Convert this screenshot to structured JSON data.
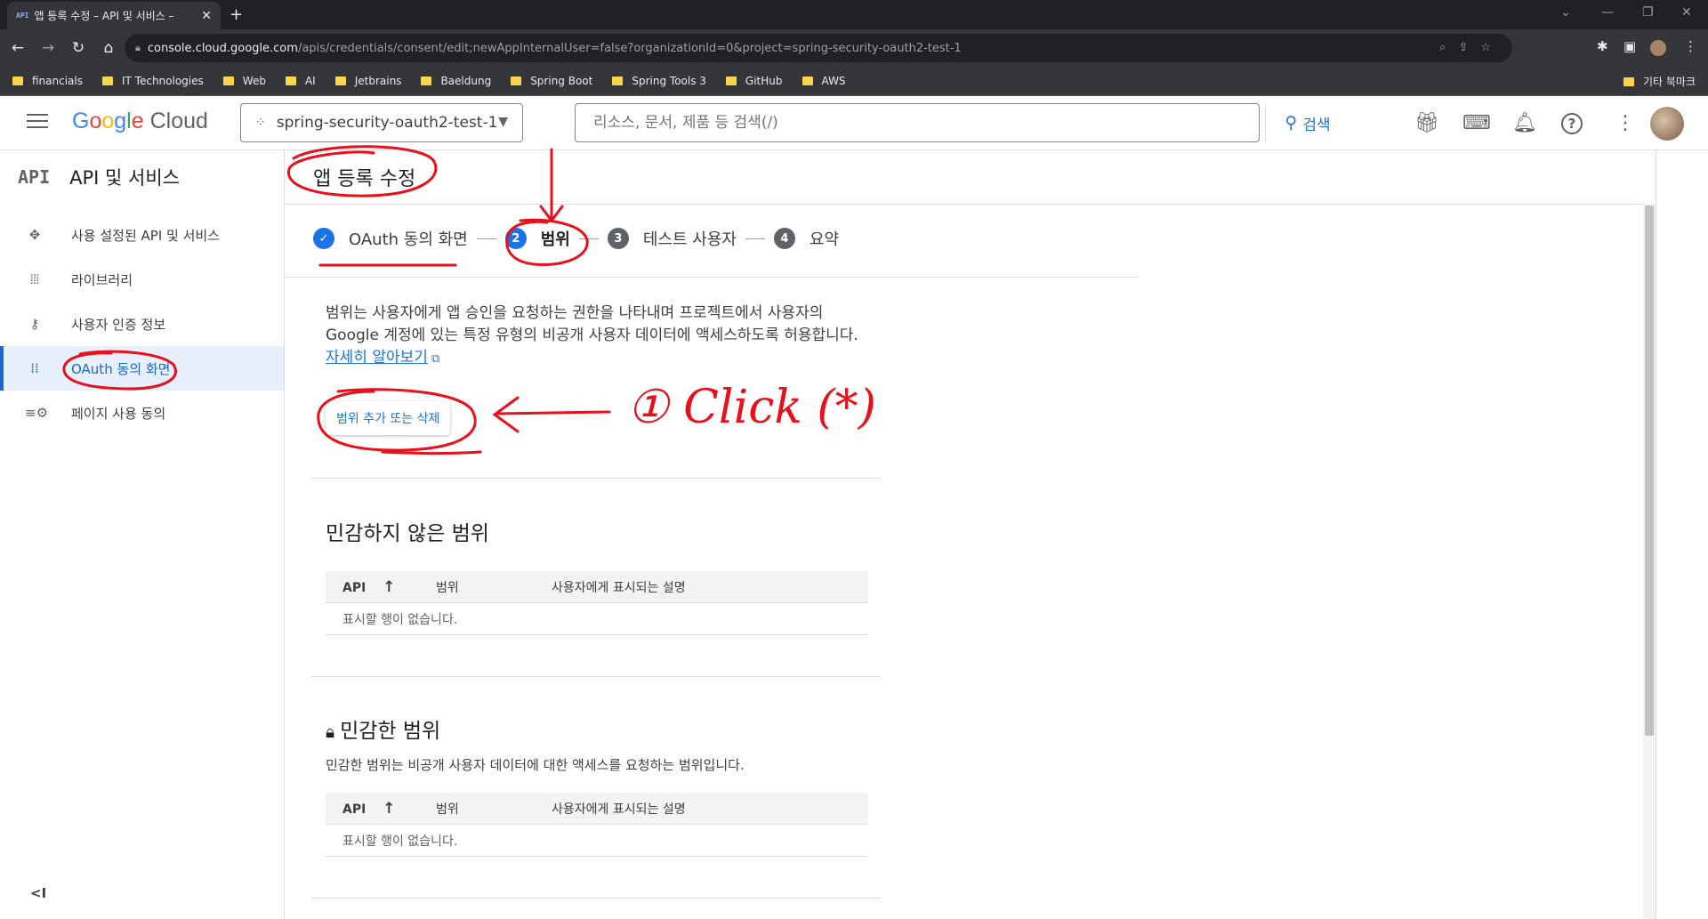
{
  "browser": {
    "tab_favicon": "API",
    "tab_title": "앱 등록 수정 – API 및 서비스 – ",
    "new_tab": "+",
    "url_host": "console.cloud.google.com",
    "url_path": "/apis/credentials/consent/edit;newAppInternalUser=false?organizationId=0&project=spring-security-oauth2-test-1",
    "bookmarks": [
      "financials",
      "IT Technologies",
      "Web",
      "AI",
      "Jetbrains",
      "Baeldung",
      "Spring Boot",
      "Spring Tools 3",
      "GitHub",
      "AWS"
    ],
    "other_bookmarks": "기타 북마크"
  },
  "header": {
    "logo_google": "Google",
    "logo_cloud": "Cloud",
    "project": "spring-security-oauth2-test-1",
    "search_placeholder": "리소스, 문서, 제품 등 검색(/)",
    "search_button": "검색"
  },
  "sidebar": {
    "api_badge": "API",
    "title": "API 및 서비스",
    "items": [
      {
        "label": "사용 설정된 API 및 서비스",
        "icon": "diamond-icon"
      },
      {
        "label": "라이브러리",
        "icon": "library-icon"
      },
      {
        "label": "사용자 인증 정보",
        "icon": "key-icon"
      },
      {
        "label": "OAuth 동의 화면",
        "icon": "oauth-icon"
      },
      {
        "label": "페이지 사용 동의",
        "icon": "settings-list-icon"
      }
    ],
    "collapse": "<I"
  },
  "page": {
    "title": "앱 등록 수정",
    "steps": [
      {
        "number": "",
        "label": "OAuth 동의 화면",
        "state": "done"
      },
      {
        "number": "2",
        "label": "범위",
        "state": "active"
      },
      {
        "number": "3",
        "label": "테스트 사용자",
        "state": "pending"
      },
      {
        "number": "4",
        "label": "요약",
        "state": "pending"
      }
    ],
    "description": "범위는 사용자에게 앱 승인을 요청하는 권한을 나타내며 프로젝트에서 사용자의 Google 계정에 있는 특정 유형의 비공개 사용자 데이터에 액세스하도록 허용합니다.",
    "learn_more": "자세히 알아보기",
    "add_scope_button": "범위 추가 또는 삭제",
    "nonsensitive": {
      "heading": "민감하지 않은 범위",
      "columns": [
        "API",
        "범위",
        "사용자에게 표시되는 설명"
      ],
      "empty": "표시할 행이 없습니다."
    },
    "sensitive": {
      "heading": "민감한 범위",
      "subtitle": "민감한 범위는 비공개 사용자 데이터에 대한 액세스를 요청하는 범위입니다.",
      "columns": [
        "API",
        "범위",
        "사용자에게 표시되는 설명"
      ],
      "empty": "표시할 행이 없습니다."
    }
  },
  "annotation": {
    "text": "① Click (*)",
    "color": "#e8101a"
  },
  "colors": {
    "accent": "#1a73e8",
    "step_active": "#1a73e8",
    "step_pending": "#5f6368",
    "folder": "#fbd44c"
  }
}
